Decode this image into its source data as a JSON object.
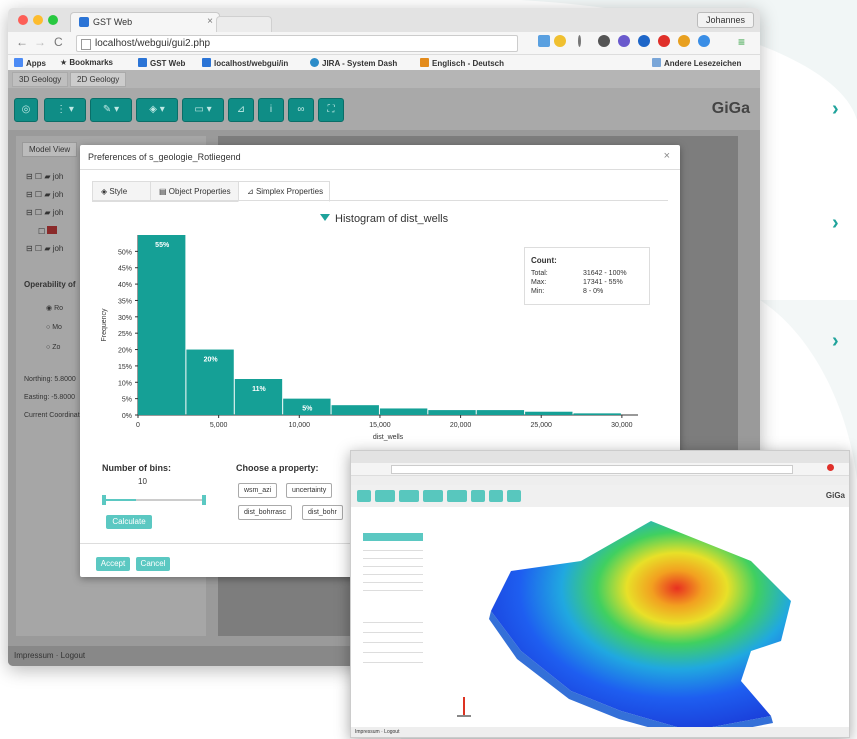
{
  "browser": {
    "tab_title": "GST Web",
    "user": "Johannes",
    "url": "localhost/webgui/gui2.php",
    "bookmarks": [
      "Apps",
      "Bookmarks",
      "GST Web",
      "localhost/webgui/in",
      "JIRA - System Dash",
      "Englisch - Deutsch",
      "Andere Lesezeichen"
    ]
  },
  "app": {
    "tabs": [
      "3D Geology",
      "2D Geology"
    ],
    "logo": "GiGa",
    "left_tab": "Model View",
    "tree_items": [
      "joh",
      "joh",
      "joh",
      "joh"
    ],
    "operability_label": "Operability of",
    "op_options": [
      "Ro",
      "Mo",
      "Zo"
    ],
    "northing": "Northing: 5.8000",
    "easting": "Easting: -5.8000",
    "current": "Current Coordinate",
    "status": "Impressum · Logout"
  },
  "modal": {
    "title": "Preferences of s_geologie_Rotliegend",
    "close": "×",
    "tabs": [
      "Style",
      "Object Properties",
      "Simplex Properties"
    ],
    "histogram_title": "Histogram of dist_wells",
    "count": {
      "heading": "Count:",
      "rows": [
        {
          "k": "Total:",
          "v": "31642 - 100%"
        },
        {
          "k": "Max:",
          "v": "17341 - 55%"
        },
        {
          "k": "Min:",
          "v": "8 - 0%"
        }
      ]
    },
    "bins_label": "Number of bins:",
    "bins_value": "10",
    "calculate": "Calculate",
    "property_label": "Choose a property:",
    "properties": [
      "wsm_azi",
      "uncertainty",
      "dist_bohrrasc",
      "dist_bohr"
    ],
    "accept": "Accept",
    "cancel": "Cancel"
  },
  "chart_data": {
    "type": "bar",
    "title": "Histogram of dist_wells",
    "xlabel": "dist_wells",
    "ylabel": "Frequency",
    "x_bin_starts": [
      0,
      3000,
      6000,
      9000,
      12000,
      15000,
      18000,
      21000,
      24000,
      27000
    ],
    "bin_width": 3000,
    "values": [
      55,
      20,
      11,
      5,
      3,
      2,
      1.5,
      1.5,
      1,
      0.5
    ],
    "data_labels": [
      "55%",
      "20%",
      "11%",
      "5%",
      "",
      "",
      "",
      "",
      "",
      ""
    ],
    "ylim": [
      0,
      55
    ],
    "yticks": [
      "0%",
      "5%",
      "10%",
      "15%",
      "20%",
      "25%",
      "30%",
      "35%",
      "40%",
      "45%",
      "50%"
    ],
    "xticks": [
      "0",
      "5,000",
      "10,000",
      "15,000",
      "20,000",
      "25,000",
      "30,000"
    ],
    "color": "#15a096"
  },
  "inset": {
    "logo": "GiGa",
    "status": "Impressum · Logout"
  }
}
